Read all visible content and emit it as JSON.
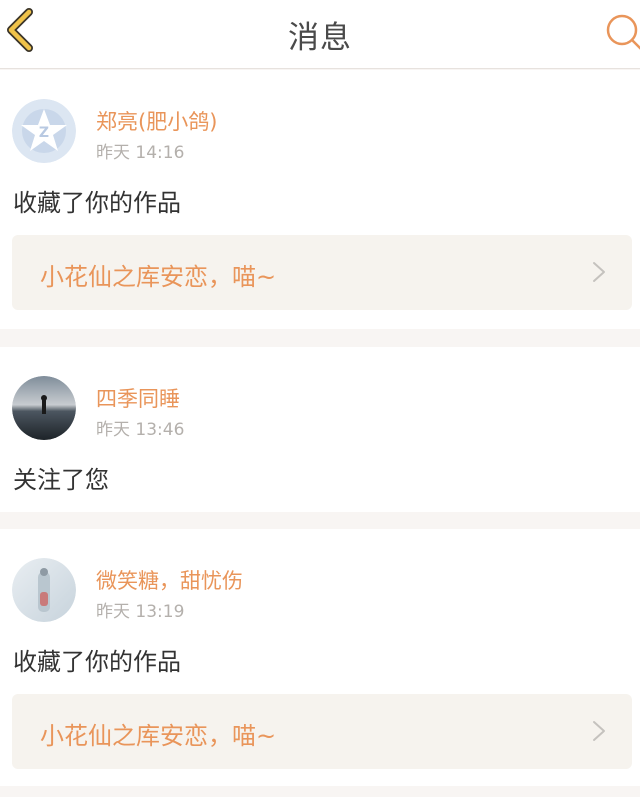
{
  "header": {
    "title": "消息",
    "back_icon": "chevron-left-icon",
    "search_icon": "search-icon"
  },
  "colors": {
    "accent": "#e9955a",
    "back_arrow": "#f0c34a",
    "text_dark": "#333333",
    "text_muted": "#b4b0ac",
    "card_bg": "#f6f3ee",
    "page_bg": "#f8f5f3"
  },
  "messages": [
    {
      "user": "郑亮(肥小鸽)",
      "time": "昨天 14:16",
      "action": "收藏了你的作品",
      "work": "小花仙之库安恋，喵~"
    },
    {
      "user": "四季同睡",
      "time": "昨天 13:46",
      "action": "关注了您"
    },
    {
      "user": "微笑糖，甜忧伤",
      "time": "昨天 13:19",
      "action": "收藏了你的作品",
      "work": "小花仙之库安恋，喵~"
    }
  ]
}
